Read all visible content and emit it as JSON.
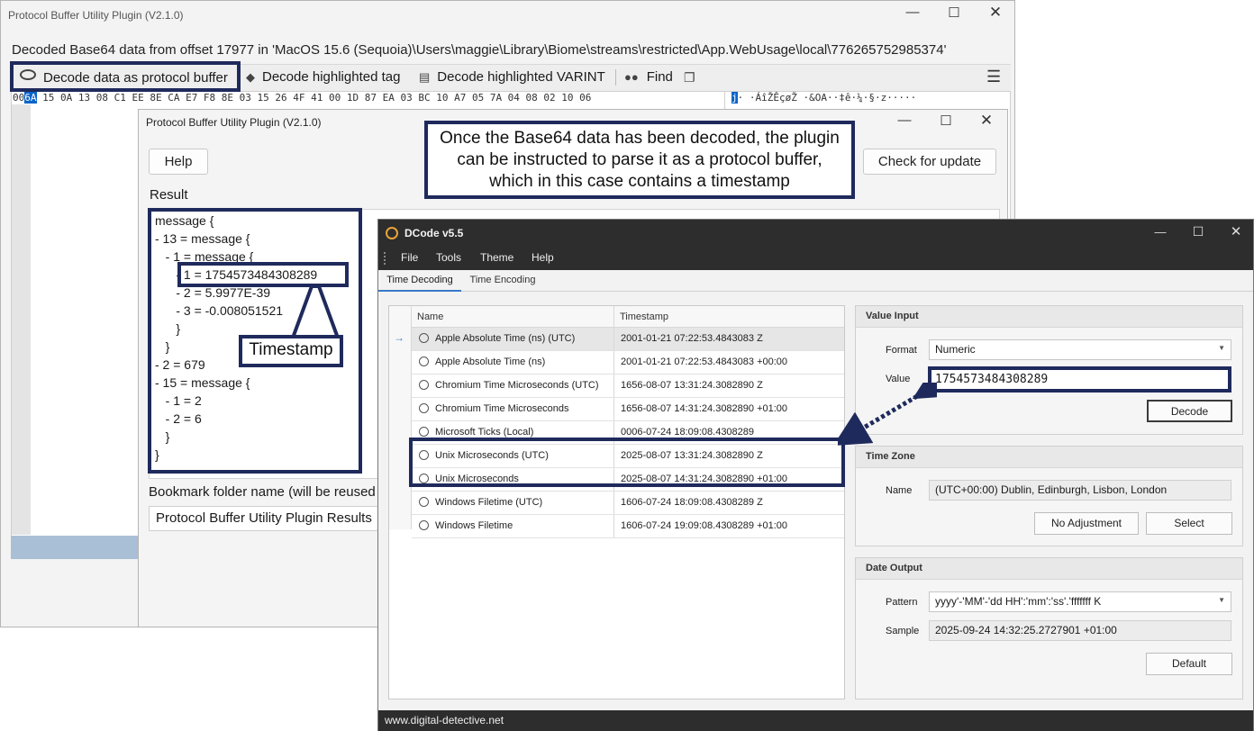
{
  "outer": {
    "title": "Protocol Buffer Utility Plugin (V2.1.0)",
    "decoded_info": "Decoded Base64 data from offset 17977 in 'MacOS 15.6 (Sequoia)\\Users\\maggie\\Library\\Biome\\streams\\restricted\\App.WebUsage\\local\\776265752985374'",
    "toolbar": {
      "decode_pb": "Decode data as protocol buffer",
      "decode_tag": "Decode highlighted tag",
      "decode_varint": "Decode highlighted VARINT",
      "find": "Find"
    },
    "hex": {
      "offset": "00",
      "selected": "6A",
      "bytes": "15 0A 13 08 C1 EE 8E CA E7 F8 8E 03 15 26 4F 41 00 1D 87 EA 03 BC 10 A7 05 7A 04 08 02 10 06",
      "ascii_sel": "j",
      "ascii": "· ·ÁîŽÊçøŽ ·&OA··‡ê·¼·§·z·····"
    }
  },
  "inner": {
    "title": "Protocol Buffer Utility Plugin (V2.1.0)",
    "help": "Help",
    "check_update": "Check for update",
    "result_label": "Result",
    "tree": [
      "message {",
      "- 13 = message {",
      "   - 1 = message {",
      "      - 1 = 1754573484308289",
      "      - 2 = 5.9977E-39",
      "      - 3 = -0.008051521",
      "      }",
      "   }",
      "- 2 = 679",
      "- 15 = message {",
      "   - 1 = 2",
      "   - 2 = 6",
      "   }",
      "}"
    ],
    "bookmark_label": "Bookmark folder name (will be reused",
    "bookmark_value": "Protocol Buffer Utility Plugin Results"
  },
  "annotations": {
    "callout": "Once the Base64 data has been decoded, the plugin can be instructed to parse it as a protocol buffer, which in this case contains a timestamp",
    "timestamp": "Timestamp"
  },
  "dcode": {
    "title": "DCode v5.5",
    "menu": [
      "File",
      "Tools",
      "Theme",
      "Help"
    ],
    "tabs": [
      "Time Decoding",
      "Time Encoding"
    ],
    "columns": [
      "Name",
      "Timestamp"
    ],
    "rows": [
      {
        "name": "Apple Absolute Time (ns) (UTC)",
        "ts": "2001-01-21 07:22:53.4843083 Z"
      },
      {
        "name": "Apple Absolute Time (ns)",
        "ts": "2001-01-21 07:22:53.4843083 +00:00"
      },
      {
        "name": "Chromium Time Microseconds (UTC)",
        "ts": "1656-08-07 13:31:24.3082890 Z"
      },
      {
        "name": "Chromium Time Microseconds",
        "ts": "1656-08-07 14:31:24.3082890 +01:00"
      },
      {
        "name": "Microsoft Ticks (Local)",
        "ts": "0006-07-24 18:09:08.4308289"
      },
      {
        "name": "Unix Microseconds (UTC)",
        "ts": "2025-08-07 13:31:24.3082890 Z"
      },
      {
        "name": "Unix Microseconds",
        "ts": "2025-08-07 14:31:24.3082890 +01:00"
      },
      {
        "name": "Windows Filetime (UTC)",
        "ts": "1606-07-24 18:09:08.4308289 Z"
      },
      {
        "name": "Windows Filetime",
        "ts": "1606-07-24 19:09:08.4308289 +01:00"
      }
    ],
    "value_input": {
      "header": "Value Input",
      "format_label": "Format",
      "format_value": "Numeric",
      "value_label": "Value",
      "value": "1754573484308289",
      "decode": "Decode"
    },
    "time_zone": {
      "header": "Time Zone",
      "name_label": "Name",
      "name_value": "(UTC+00:00) Dublin, Edinburgh, Lisbon, London",
      "no_adjust": "No Adjustment",
      "select": "Select"
    },
    "date_output": {
      "header": "Date Output",
      "pattern_label": "Pattern",
      "pattern_value": "yyyy'-'MM'-'dd HH':'mm':'ss'.'fffffff K",
      "sample_label": "Sample",
      "sample_value": "2025-09-24 14:32:25.2727901 +01:00",
      "default": "Default"
    },
    "status": "www.digital-detective.net"
  }
}
